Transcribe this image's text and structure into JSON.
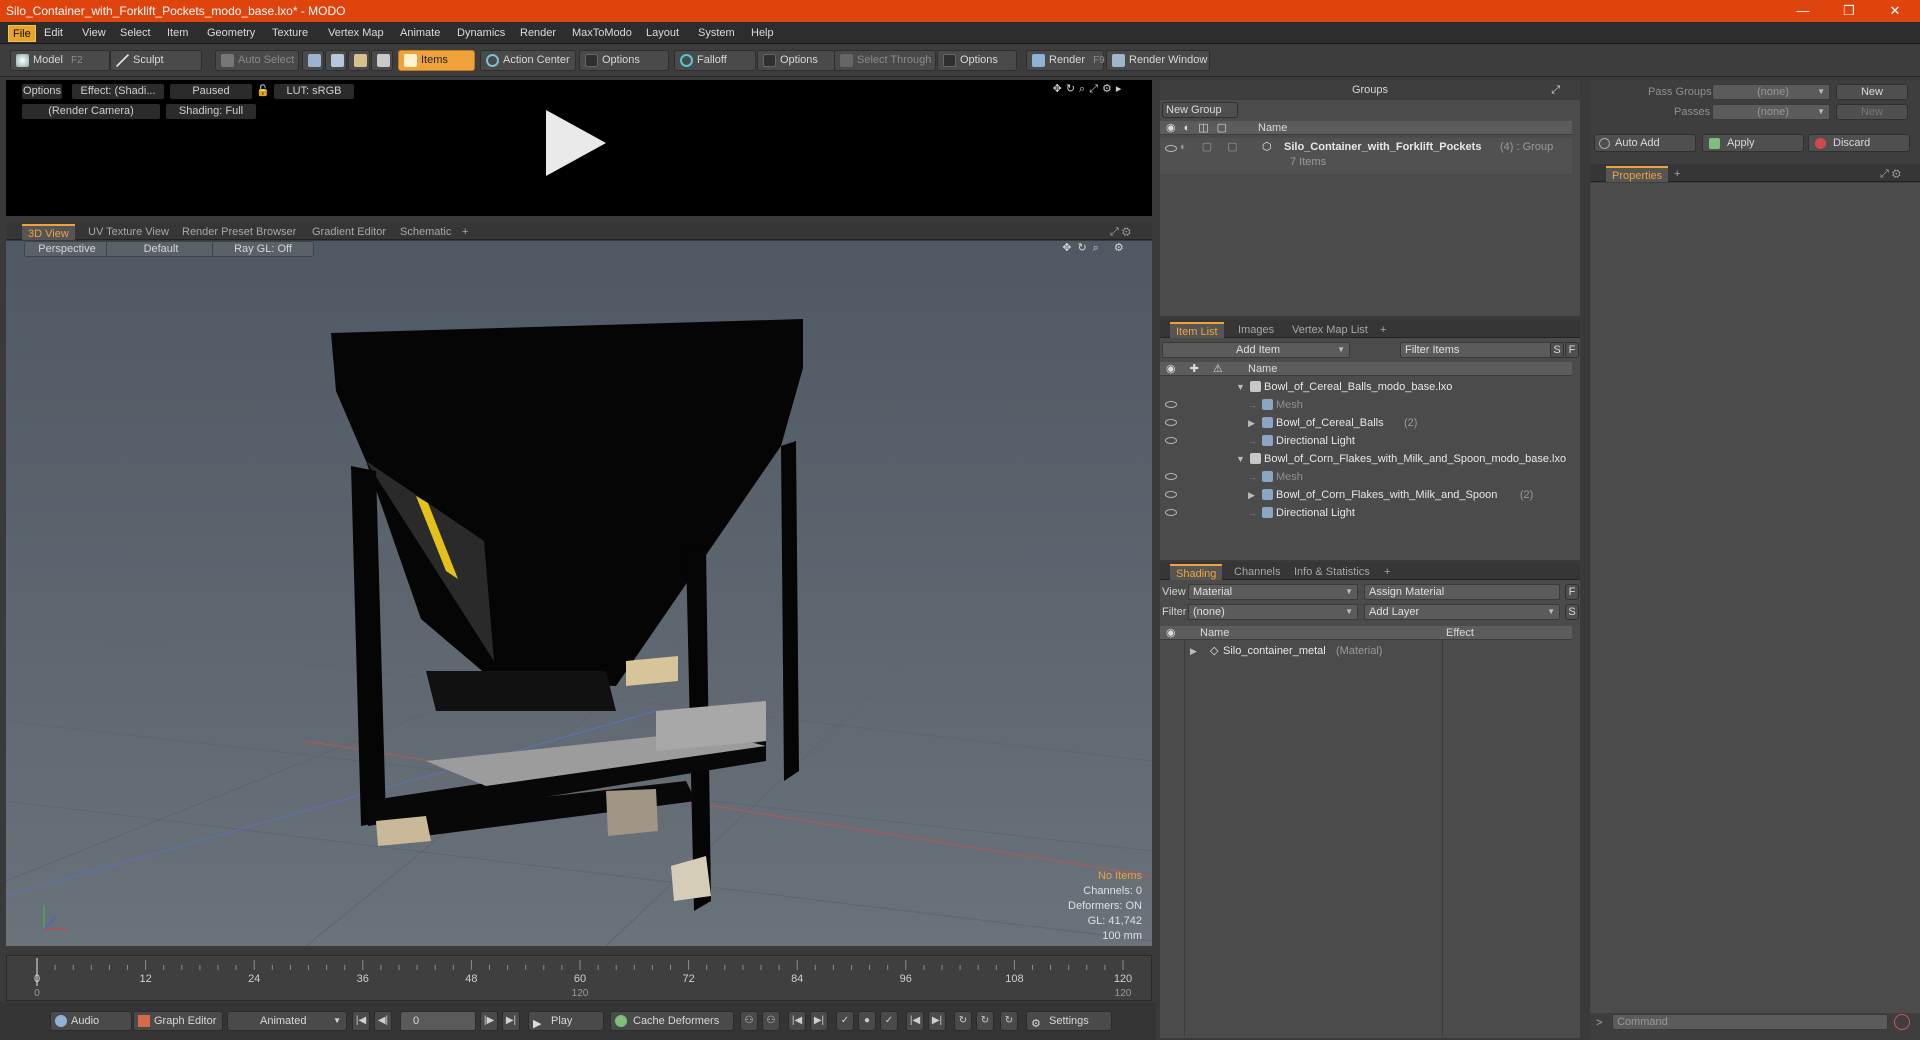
{
  "window": {
    "title": "Silo_Container_with_Forklift_Pockets_modo_base.lxo* - MODO",
    "minimize": "—",
    "restore": "❐",
    "close": "✕"
  },
  "menu": [
    "File",
    "Edit",
    "View",
    "Select",
    "Item",
    "Geometry",
    "Texture",
    "Vertex Map",
    "Animate",
    "Dynamics",
    "Render",
    "MaxToModo",
    "Layout",
    "System",
    "Help"
  ],
  "toolbar": {
    "model": "Model",
    "model_key": "F2",
    "sculpt": "Sculpt",
    "auto_select": "Auto Select",
    "items": "Items",
    "action_center": "Action Center",
    "options1": "Options",
    "falloff": "Falloff",
    "options2": "Options",
    "select_through": "Select Through",
    "options3": "Options",
    "render": "Render",
    "render_key": "F9",
    "render_window": "Render Window"
  },
  "preview": {
    "options": "Options",
    "effect": "Effect: (Shadi...",
    "paused": "Paused",
    "lut": "LUT: sRGB",
    "camera": "(Render Camera)",
    "shading": "Shading: Full"
  },
  "viewport_tabs": [
    "3D View",
    "UV Texture View",
    "Render Preset Browser",
    "Gradient Editor",
    "Schematic"
  ],
  "viewport": {
    "perspective": "Perspective",
    "default": "Default",
    "raygl": "Ray GL: Off"
  },
  "stats": {
    "no_items": "No Items",
    "channels": "Channels: 0",
    "deformers": "Deformers: ON",
    "gl": "GL: 41,742",
    "unit": "100 mm"
  },
  "timeline": {
    "ticks": [
      "0",
      "12",
      "24",
      "36",
      "48",
      "60",
      "72",
      "84",
      "96",
      "108",
      "120"
    ],
    "sub_ticks": [
      "0",
      "120",
      "120"
    ]
  },
  "transport": {
    "audio": "Audio",
    "graph_editor": "Graph Editor",
    "animated": "Animated",
    "frame": "0",
    "play": "Play",
    "cache": "Cache Deformers",
    "settings": "Settings"
  },
  "groups": {
    "title": "Groups",
    "new_group": "New Group",
    "col_name": "Name",
    "item_name": "Silo_Container_with_Forklift_Pockets",
    "item_count": "(4)",
    "item_type": ": Group",
    "item_sub": "7 Items"
  },
  "itemlist": {
    "tabs": [
      "Item List",
      "Images",
      "Vertex Map List"
    ],
    "add_item": "Add Item",
    "filter": "Filter Items",
    "s": "S",
    "f": "F",
    "col_name": "Name",
    "rows": [
      {
        "label": "Bowl_of_Cereal_Balls_modo_base.lxo",
        "extra": "",
        "indent": 0,
        "eye": false,
        "arrow": "▼"
      },
      {
        "label": "Mesh",
        "extra": "",
        "indent": 1,
        "eye": true,
        "arrow": "",
        "dim": true
      },
      {
        "label": "Bowl_of_Cereal_Balls",
        "extra": "(2)",
        "indent": 1,
        "eye": true,
        "arrow": "▶"
      },
      {
        "label": "Directional Light",
        "extra": "",
        "indent": 1,
        "eye": true,
        "arrow": ""
      },
      {
        "label": "Bowl_of_Corn_Flakes_with_Milk_and_Spoon_modo_base.lxo",
        "extra": "",
        "indent": 0,
        "eye": false,
        "arrow": "▼"
      },
      {
        "label": "Mesh",
        "extra": "",
        "indent": 1,
        "eye": true,
        "arrow": "",
        "dim": true
      },
      {
        "label": "Bowl_of_Corn_Flakes_with_Milk_and_Spoon",
        "extra": "(2)",
        "indent": 1,
        "eye": true,
        "arrow": "▶"
      },
      {
        "label": "Directional Light",
        "extra": "",
        "indent": 1,
        "eye": true,
        "arrow": ""
      }
    ]
  },
  "shading": {
    "tabs": [
      "Shading",
      "Channels",
      "Info & Statistics"
    ],
    "view_label": "View",
    "view_value": "Material",
    "assign": "Assign Material",
    "f": "F",
    "filter_label": "Filter",
    "filter_value": "(none)",
    "add_layer": "Add Layer",
    "s": "S",
    "col_name": "Name",
    "col_effect": "Effect",
    "material": "Silo_container_metal",
    "material_type": "(Material)"
  },
  "props": {
    "pass_groups": "Pass Groups",
    "passes": "Passes",
    "none1": "(none)",
    "none2": "(none)",
    "new1": "New",
    "new2": "New",
    "auto_add": "Auto Add",
    "apply": "Apply",
    "discard": "Discard",
    "tab": "Properties",
    "command": "Command"
  },
  "colors": {
    "accent": "#f0a33a",
    "titlebar": "#e0440e",
    "hazard": "#e2c21a"
  }
}
